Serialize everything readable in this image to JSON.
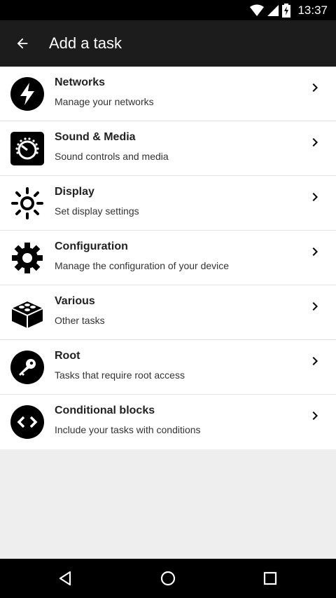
{
  "status_bar": {
    "time": "13:37",
    "icons": [
      "wifi-icon",
      "cell-signal-icon",
      "battery-charging-icon"
    ]
  },
  "app_bar": {
    "title": "Add a task",
    "back_icon": "arrow-back-icon"
  },
  "items": [
    {
      "title": "Networks",
      "subtitle": "Manage your networks",
      "icon": "lightning-icon"
    },
    {
      "title": "Sound & Media",
      "subtitle": "Sound controls and media",
      "icon": "volume-knob-icon"
    },
    {
      "title": "Display",
      "subtitle": "Set display settings",
      "icon": "sun-icon"
    },
    {
      "title": "Configuration",
      "subtitle": "Manage the configuration of your device",
      "icon": "gear-icon"
    },
    {
      "title": "Various",
      "subtitle": "Other tasks",
      "icon": "lego-brick-icon"
    },
    {
      "title": "Root",
      "subtitle": "Tasks that require root access",
      "icon": "key-icon"
    },
    {
      "title": "Conditional blocks",
      "subtitle": "Include your tasks with conditions",
      "icon": "code-brackets-icon"
    }
  ],
  "nav_bar": {
    "buttons": [
      "back-triangle-icon",
      "home-circle-icon",
      "recents-square-icon"
    ]
  },
  "colors": {
    "status_bar": "#000000",
    "app_bar": "#1c1c1c",
    "list_background": "#ffffff",
    "page_background": "#eeeeee"
  }
}
